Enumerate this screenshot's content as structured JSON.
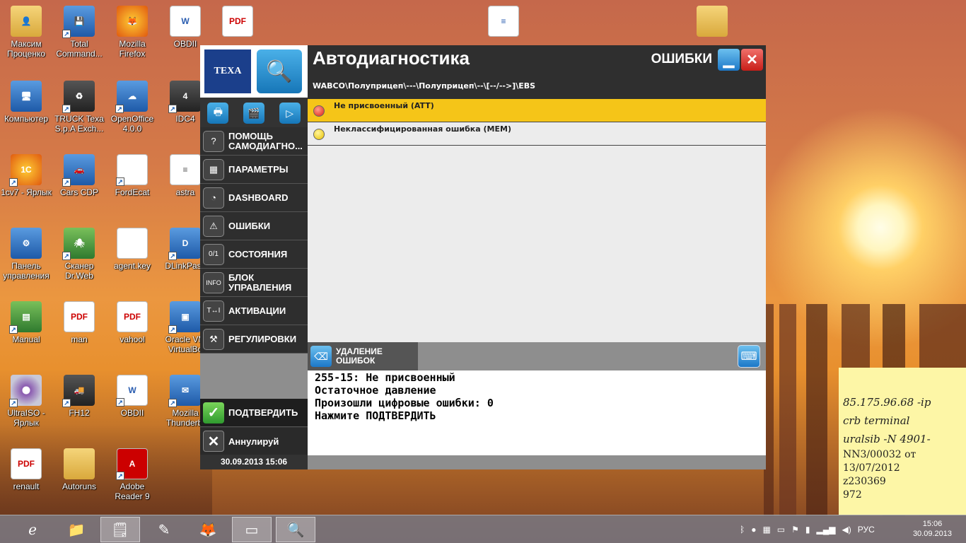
{
  "desktop": {
    "icons": [
      {
        "label": "Максим Проценко",
        "icon": "user-folder-icon"
      },
      {
        "label": "Total Command...",
        "icon": "floppy-icon"
      },
      {
        "label": "Mozilla Firefox",
        "icon": "firefox-icon"
      },
      {
        "label": "OBDII",
        "icon": "document-icon"
      },
      {
        "label": "",
        "icon": "pdf-icon"
      },
      {
        "label": "",
        "icon": "document-icon"
      },
      {
        "label": "",
        "icon": "folder-icon"
      },
      {
        "label": "Компьютер",
        "icon": "computer-icon"
      },
      {
        "label": "TRUCK Texa S.p.A Exch...",
        "icon": "recycle-icon"
      },
      {
        "label": "OpenOffice 4.0.0",
        "icon": "openoffice-icon"
      },
      {
        "label": "IDC4",
        "icon": "idc4-icon"
      },
      {
        "label": "1cv7 - Ярлык",
        "icon": "1c-icon"
      },
      {
        "label": "Cars CDP",
        "icon": "car-icon"
      },
      {
        "label": "FordEcat",
        "icon": "file-icon"
      },
      {
        "label": "astra",
        "icon": "text-file-icon"
      },
      {
        "label": "Панель управления",
        "icon": "control-panel-icon"
      },
      {
        "label": "Сканер Dr.Web",
        "icon": "drweb-icon"
      },
      {
        "label": "agent.key",
        "icon": "file-icon"
      },
      {
        "label": "DLinkPass",
        "icon": "dlink-icon"
      },
      {
        "label": "Manual",
        "icon": "window-icon"
      },
      {
        "label": "man",
        "icon": "pdf-icon"
      },
      {
        "label": "vahool",
        "icon": "pdf-icon"
      },
      {
        "label": "Oracle VM VirtualBo",
        "icon": "virtualbox-icon"
      },
      {
        "label": "UltraISO - Ярлык",
        "icon": "disc-icon"
      },
      {
        "label": "FH12",
        "icon": "truck-icon"
      },
      {
        "label": "OBDII",
        "icon": "word-icon"
      },
      {
        "label": "Mozilla Thunderbi",
        "icon": "thunderbird-icon"
      },
      {
        "label": "renault",
        "icon": "pdf-icon"
      },
      {
        "label": "Autoruns",
        "icon": "folder-icon"
      },
      {
        "label": "Adobe Reader 9",
        "icon": "adobe-reader-icon"
      }
    ]
  },
  "texa": {
    "logo": "TEXA",
    "title": "Автодиагностика",
    "section": "ОШИБКИ",
    "path": "WABCO\\Полуприцеп\\---\\Полуприцеп\\--\\[--/-->]\\EBS",
    "menu": [
      {
        "label": "ПОМОЩЬ САМОДИАГНО...",
        "icon": "help-icon",
        "glyph": "?"
      },
      {
        "label": "ПАРАМЕТРЫ",
        "icon": "grid-icon",
        "glyph": "▦"
      },
      {
        "label": "DASHBOARD",
        "icon": "gauge-icon",
        "glyph": "◔"
      },
      {
        "label": "ОШИБКИ",
        "icon": "warning-icon",
        "glyph": "⚠"
      },
      {
        "label": "СОСТОЯНИЯ",
        "icon": "switch-icon",
        "glyph": "0/1"
      },
      {
        "label": "БЛОК УПРАВЛЕНИЯ",
        "icon": "info-icon",
        "glyph": "INFO"
      },
      {
        "label": "АКТИВАЦИИ",
        "icon": "activation-icon",
        "glyph": "T↔I"
      },
      {
        "label": "РЕГУЛИРОВКИ",
        "icon": "tools-icon",
        "glyph": "⚒"
      }
    ],
    "errors": [
      {
        "text": "Не присвоенный (ATT)",
        "status": "red"
      },
      {
        "text": "Неклассифицированная ошибка (MEM)",
        "status": "yellow"
      }
    ],
    "delete_label": "УДАЛЕНИЕ ОШИБОК",
    "info_lines": [
      "255-15: Не присвоенный",
      "Остаточное давление",
      "Произошли цифровые ошибки: 0",
      "Нажмите ПОДТВЕРДИТЬ"
    ],
    "confirm_label": "ПОДТВЕРДИТЬ",
    "cancel_label": "Аннулируй",
    "datetime": "30.09.2013  15:06"
  },
  "note": {
    "lines": [
      "85.175.96.68 -ip",
      "crb terminal",
      "uralsib -N 4901-",
      "NN3/00032 от",
      "13/07/2012",
      "z230369",
      "972"
    ]
  },
  "taskbar": {
    "language": "РУС",
    "time": "15:06",
    "date": "30.09.2013"
  },
  "colors": {
    "selected_row": "#f5c518",
    "window_dark": "#333333",
    "accent_blue": "#1c78c8"
  }
}
